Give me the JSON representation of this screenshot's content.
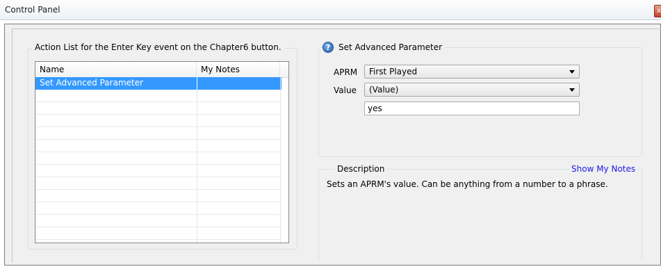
{
  "window": {
    "title": "Control Panel",
    "close_glyph": "x"
  },
  "action_list": {
    "group_title": "Action List for the Enter Key event on the Chapter6 button.",
    "columns": [
      "Name",
      "My Notes"
    ],
    "rows": [
      {
        "name": "Set Advanced Parameter",
        "notes": "",
        "selected": true
      }
    ]
  },
  "parameter": {
    "title": "Set Advanced Parameter",
    "help_icon": "help-icon",
    "aprm_label": "APRM",
    "aprm_value": "First Played",
    "value_label": "Value",
    "value_value": "(Value)",
    "text_value": "yes"
  },
  "description": {
    "title": "Description",
    "show_notes_link": "Show My Notes",
    "text": "Sets an APRM's value. Can be anything from a number to a phrase."
  },
  "colors": {
    "selection": "#3399ff",
    "link": "#1a1ae6"
  }
}
